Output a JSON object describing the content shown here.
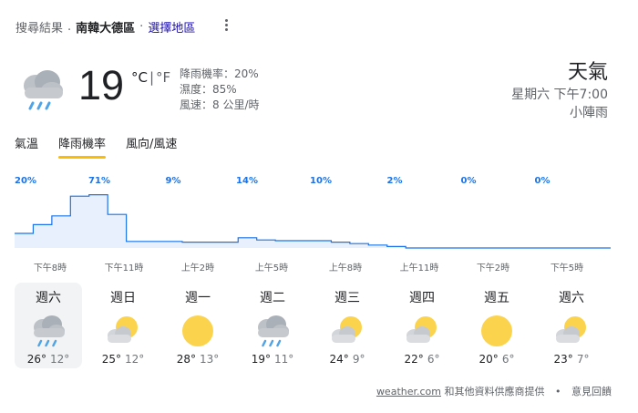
{
  "header": {
    "search_results_label": "搜尋結果",
    "dot": ".",
    "location": "南韓大德區",
    "middot": "·",
    "select_region": "選擇地區"
  },
  "current": {
    "temperature": "19",
    "unit_c": "°C",
    "unit_sep": "|",
    "unit_f": "°F",
    "precip_text": "降雨機率：20%",
    "humidity_text": "濕度：85%",
    "wind_text": "風速：8 公里/時",
    "icon": "rain-cloud-icon"
  },
  "summary": {
    "title": "天氣",
    "datetime": "星期六 下午7:00",
    "condition": "小陣雨"
  },
  "tabs": [
    {
      "label": "氣溫",
      "active": false
    },
    {
      "label": "降雨機率",
      "active": true
    },
    {
      "label": "風向/風速",
      "active": false
    }
  ],
  "chart_data": {
    "type": "area",
    "title": "",
    "xlabel": "",
    "ylabel": "",
    "ylim": [
      0,
      100
    ],
    "labeled_points": [
      {
        "label": "20%",
        "value": 20
      },
      {
        "label": "71%",
        "value": 71
      },
      {
        "label": "9%",
        "value": 9
      },
      {
        "label": "14%",
        "value": 14
      },
      {
        "label": "10%",
        "value": 10
      },
      {
        "label": "2%",
        "value": 2
      },
      {
        "label": "0%",
        "value": 0
      },
      {
        "label": "0%",
        "value": 0
      }
    ],
    "hourly_values": [
      20,
      32,
      44,
      71,
      73,
      46,
      9,
      9,
      9,
      8,
      8,
      8,
      14,
      11,
      10,
      10,
      10,
      8,
      6,
      4,
      2,
      0,
      0,
      0,
      0,
      0,
      0,
      0,
      0,
      0,
      0,
      0
    ],
    "x_tick_labels": [
      "下午8時",
      "下午11時",
      "上午2時",
      "上午5時",
      "上午8時",
      "上午11時",
      "下午2時",
      "下午5時"
    ],
    "fill_color": "#e8f0fe",
    "line_color": "#1a73e8"
  },
  "forecast": [
    {
      "day": "週六",
      "hi": "26°",
      "lo": "12°",
      "icon": "rain-cloud-icon",
      "selected": true
    },
    {
      "day": "週日",
      "hi": "25°",
      "lo": "12°",
      "icon": "partly-cloudy-icon",
      "selected": false
    },
    {
      "day": "週一",
      "hi": "28°",
      "lo": "13°",
      "icon": "sunny-icon",
      "selected": false
    },
    {
      "day": "週二",
      "hi": "19°",
      "lo": "11°",
      "icon": "rain-cloud-icon",
      "selected": false
    },
    {
      "day": "週三",
      "hi": "24°",
      "lo": "9°",
      "icon": "partly-cloudy-icon",
      "selected": false
    },
    {
      "day": "週四",
      "hi": "22°",
      "lo": "6°",
      "icon": "partly-cloudy-icon",
      "selected": false
    },
    {
      "day": "週五",
      "hi": "20°",
      "lo": "6°",
      "icon": "sunny-icon",
      "selected": false
    },
    {
      "day": "週六",
      "hi": "23°",
      "lo": "7°",
      "icon": "partly-cloudy-icon",
      "selected": false
    }
  ],
  "footer": {
    "source": "weather.com",
    "source_suffix": " 和其他資料供應商提供",
    "bullet": "•",
    "feedback": "意見回饋"
  }
}
